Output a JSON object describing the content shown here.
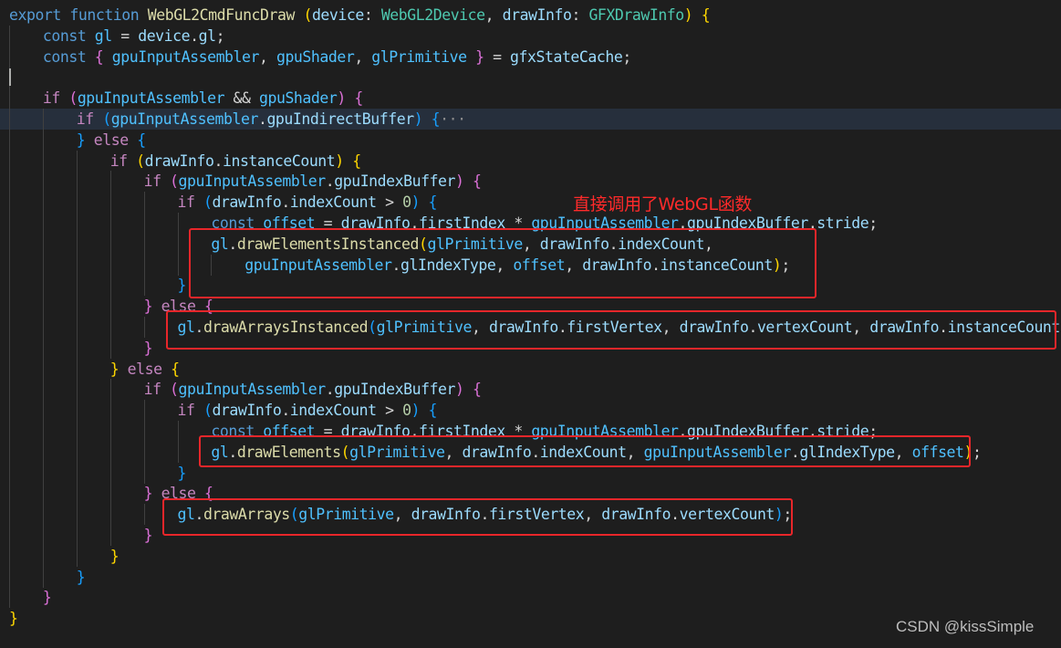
{
  "colors": {
    "background": "#1e1e1e",
    "highlight_line": "#262f3c",
    "keyword": "#569cd6",
    "control": "#c586c0",
    "function": "#dcdcaa",
    "type": "#4ec9b0",
    "variable": "#9cdcfe",
    "constant": "#4fc1ff",
    "number": "#b5cea8",
    "annotation_box": "#e8262a"
  },
  "code": [
    {
      "indent": 0,
      "tokens": [
        [
          "kw",
          "export"
        ],
        [
          "op",
          " "
        ],
        [
          "kw",
          "function"
        ],
        [
          "op",
          " "
        ],
        [
          "fn",
          "WebGL2CmdFuncDraw"
        ],
        [
          "op",
          " "
        ],
        [
          "br1",
          "("
        ],
        [
          "pv",
          "device"
        ],
        [
          "op",
          ": "
        ],
        [
          "ty",
          "WebGL2Device"
        ],
        [
          "op",
          ", "
        ],
        [
          "pv",
          "drawInfo"
        ],
        [
          "op",
          ": "
        ],
        [
          "ty",
          "GFXDrawInfo"
        ],
        [
          "br1",
          ")"
        ],
        [
          "op",
          " "
        ],
        [
          "br1",
          "{"
        ]
      ]
    },
    {
      "indent": 1,
      "tokens": [
        [
          "kw",
          "const"
        ],
        [
          "op",
          " "
        ],
        [
          "cn",
          "gl"
        ],
        [
          "op",
          " = "
        ],
        [
          "pv",
          "device"
        ],
        [
          "op",
          "."
        ],
        [
          "pv",
          "gl"
        ],
        [
          "op",
          ";"
        ]
      ]
    },
    {
      "indent": 1,
      "tokens": [
        [
          "kw",
          "const"
        ],
        [
          "op",
          " "
        ],
        [
          "br2",
          "{"
        ],
        [
          "op",
          " "
        ],
        [
          "cn",
          "gpuInputAssembler"
        ],
        [
          "op",
          ", "
        ],
        [
          "cn",
          "gpuShader"
        ],
        [
          "op",
          ", "
        ],
        [
          "cn",
          "glPrimitive"
        ],
        [
          "op",
          " "
        ],
        [
          "br2",
          "}"
        ],
        [
          "op",
          " = "
        ],
        [
          "pv",
          "gfxStateCache"
        ],
        [
          "op",
          ";"
        ]
      ]
    },
    {
      "indent": 1,
      "cursor": true,
      "tokens": []
    },
    {
      "indent": 1,
      "tokens": [
        [
          "ctl",
          "if"
        ],
        [
          "op",
          " "
        ],
        [
          "br2",
          "("
        ],
        [
          "cn",
          "gpuInputAssembler"
        ],
        [
          "op",
          " && "
        ],
        [
          "cn",
          "gpuShader"
        ],
        [
          "br2",
          ")"
        ],
        [
          "op",
          " "
        ],
        [
          "br2",
          "{"
        ]
      ]
    },
    {
      "indent": 2,
      "highlight": true,
      "tokens": [
        [
          "ctl",
          "if"
        ],
        [
          "op",
          " "
        ],
        [
          "br3",
          "("
        ],
        [
          "cn",
          "gpuInputAssembler"
        ],
        [
          "op",
          "."
        ],
        [
          "pv",
          "gpuIndirectBuffer"
        ],
        [
          "br3",
          ")"
        ],
        [
          "op",
          " "
        ],
        [
          "br3",
          "{"
        ],
        [
          "fold",
          "···"
        ]
      ]
    },
    {
      "indent": 2,
      "tokens": [
        [
          "br3",
          "}"
        ],
        [
          "op",
          " "
        ],
        [
          "ctl",
          "else"
        ],
        [
          "op",
          " "
        ],
        [
          "br3",
          "{"
        ]
      ]
    },
    {
      "indent": 3,
      "tokens": [
        [
          "ctl",
          "if"
        ],
        [
          "op",
          " "
        ],
        [
          "br1",
          "("
        ],
        [
          "pv",
          "drawInfo"
        ],
        [
          "op",
          "."
        ],
        [
          "pv",
          "instanceCount"
        ],
        [
          "br1",
          ")"
        ],
        [
          "op",
          " "
        ],
        [
          "br1",
          "{"
        ]
      ]
    },
    {
      "indent": 4,
      "tokens": [
        [
          "ctl",
          "if"
        ],
        [
          "op",
          " "
        ],
        [
          "br2",
          "("
        ],
        [
          "cn",
          "gpuInputAssembler"
        ],
        [
          "op",
          "."
        ],
        [
          "pv",
          "gpuIndexBuffer"
        ],
        [
          "br2",
          ")"
        ],
        [
          "op",
          " "
        ],
        [
          "br2",
          "{"
        ]
      ]
    },
    {
      "indent": 5,
      "tokens": [
        [
          "ctl",
          "if"
        ],
        [
          "op",
          " "
        ],
        [
          "br3",
          "("
        ],
        [
          "pv",
          "drawInfo"
        ],
        [
          "op",
          "."
        ],
        [
          "pv",
          "indexCount"
        ],
        [
          "op",
          " > "
        ],
        [
          "nm",
          "0"
        ],
        [
          "br3",
          ")"
        ],
        [
          "op",
          " "
        ],
        [
          "br3",
          "{"
        ]
      ]
    },
    {
      "indent": 6,
      "tokens": [
        [
          "kw",
          "const"
        ],
        [
          "op",
          " "
        ],
        [
          "cn",
          "offset"
        ],
        [
          "op",
          " = "
        ],
        [
          "pv",
          "drawInfo"
        ],
        [
          "op",
          "."
        ],
        [
          "pv",
          "firstIndex"
        ],
        [
          "op",
          " * "
        ],
        [
          "cn",
          "gpuInputAssembler"
        ],
        [
          "op",
          "."
        ],
        [
          "pv",
          "gpuIndexBuffer"
        ],
        [
          "op",
          "."
        ],
        [
          "pv",
          "stride"
        ],
        [
          "op",
          ";"
        ]
      ]
    },
    {
      "indent": 6,
      "tokens": [
        [
          "cn",
          "gl"
        ],
        [
          "op",
          "."
        ],
        [
          "fn",
          "drawElementsInstanced"
        ],
        [
          "br1",
          "("
        ],
        [
          "cn",
          "glPrimitive"
        ],
        [
          "op",
          ", "
        ],
        [
          "pv",
          "drawInfo"
        ],
        [
          "op",
          "."
        ],
        [
          "pv",
          "indexCount"
        ],
        [
          "op",
          ","
        ]
      ]
    },
    {
      "indent": 7,
      "tokens": [
        [
          "cn",
          "gpuInputAssembler"
        ],
        [
          "op",
          "."
        ],
        [
          "pv",
          "glIndexType"
        ],
        [
          "op",
          ", "
        ],
        [
          "cn",
          "offset"
        ],
        [
          "op",
          ", "
        ],
        [
          "pv",
          "drawInfo"
        ],
        [
          "op",
          "."
        ],
        [
          "pv",
          "instanceCount"
        ],
        [
          "br1",
          ")"
        ],
        [
          "op",
          ";"
        ]
      ]
    },
    {
      "indent": 5,
      "tokens": [
        [
          "br3",
          "}"
        ]
      ]
    },
    {
      "indent": 4,
      "tokens": [
        [
          "br2",
          "}"
        ],
        [
          "op",
          " "
        ],
        [
          "ctl",
          "else"
        ],
        [
          "op",
          " "
        ],
        [
          "br2",
          "{"
        ]
      ]
    },
    {
      "indent": 5,
      "tokens": [
        [
          "cn",
          "gl"
        ],
        [
          "op",
          "."
        ],
        [
          "fn",
          "drawArraysInstanced"
        ],
        [
          "br3",
          "("
        ],
        [
          "cn",
          "glPrimitive"
        ],
        [
          "op",
          ", "
        ],
        [
          "pv",
          "drawInfo"
        ],
        [
          "op",
          "."
        ],
        [
          "pv",
          "firstVertex"
        ],
        [
          "op",
          ", "
        ],
        [
          "pv",
          "drawInfo"
        ],
        [
          "op",
          "."
        ],
        [
          "pv",
          "vertexCount"
        ],
        [
          "op",
          ", "
        ],
        [
          "pv",
          "drawInfo"
        ],
        [
          "op",
          "."
        ],
        [
          "pv",
          "instanceCount"
        ],
        [
          "br3",
          ")"
        ],
        [
          "op",
          ";"
        ]
      ]
    },
    {
      "indent": 4,
      "tokens": [
        [
          "br2",
          "}"
        ]
      ]
    },
    {
      "indent": 3,
      "tokens": [
        [
          "br1",
          "}"
        ],
        [
          "op",
          " "
        ],
        [
          "ctl",
          "else"
        ],
        [
          "op",
          " "
        ],
        [
          "br1",
          "{"
        ]
      ]
    },
    {
      "indent": 4,
      "tokens": [
        [
          "ctl",
          "if"
        ],
        [
          "op",
          " "
        ],
        [
          "br2",
          "("
        ],
        [
          "cn",
          "gpuInputAssembler"
        ],
        [
          "op",
          "."
        ],
        [
          "pv",
          "gpuIndexBuffer"
        ],
        [
          "br2",
          ")"
        ],
        [
          "op",
          " "
        ],
        [
          "br2",
          "{"
        ]
      ]
    },
    {
      "indent": 5,
      "tokens": [
        [
          "ctl",
          "if"
        ],
        [
          "op",
          " "
        ],
        [
          "br3",
          "("
        ],
        [
          "pv",
          "drawInfo"
        ],
        [
          "op",
          "."
        ],
        [
          "pv",
          "indexCount"
        ],
        [
          "op",
          " > "
        ],
        [
          "nm",
          "0"
        ],
        [
          "br3",
          ")"
        ],
        [
          "op",
          " "
        ],
        [
          "br3",
          "{"
        ]
      ]
    },
    {
      "indent": 6,
      "tokens": [
        [
          "kw",
          "const"
        ],
        [
          "op",
          " "
        ],
        [
          "cn",
          "offset"
        ],
        [
          "op",
          " = "
        ],
        [
          "pv",
          "drawInfo"
        ],
        [
          "op",
          "."
        ],
        [
          "pv",
          "firstIndex"
        ],
        [
          "op",
          " * "
        ],
        [
          "cn",
          "gpuInputAssembler"
        ],
        [
          "op",
          "."
        ],
        [
          "pv",
          "gpuIndexBuffer"
        ],
        [
          "op",
          "."
        ],
        [
          "pv",
          "stride"
        ],
        [
          "op",
          ";"
        ]
      ]
    },
    {
      "indent": 6,
      "tokens": [
        [
          "cn",
          "gl"
        ],
        [
          "op",
          "."
        ],
        [
          "fn",
          "drawElements"
        ],
        [
          "br1",
          "("
        ],
        [
          "cn",
          "glPrimitive"
        ],
        [
          "op",
          ", "
        ],
        [
          "pv",
          "drawInfo"
        ],
        [
          "op",
          "."
        ],
        [
          "pv",
          "indexCount"
        ],
        [
          "op",
          ", "
        ],
        [
          "cn",
          "gpuInputAssembler"
        ],
        [
          "op",
          "."
        ],
        [
          "pv",
          "glIndexType"
        ],
        [
          "op",
          ", "
        ],
        [
          "cn",
          "offset"
        ],
        [
          "br1",
          ")"
        ],
        [
          "op",
          ";"
        ]
      ]
    },
    {
      "indent": 5,
      "tokens": [
        [
          "br3",
          "}"
        ]
      ]
    },
    {
      "indent": 4,
      "tokens": [
        [
          "br2",
          "}"
        ],
        [
          "op",
          " "
        ],
        [
          "ctl",
          "else"
        ],
        [
          "op",
          " "
        ],
        [
          "br2",
          "{"
        ]
      ]
    },
    {
      "indent": 5,
      "tokens": [
        [
          "cn",
          "gl"
        ],
        [
          "op",
          "."
        ],
        [
          "fn",
          "drawArrays"
        ],
        [
          "br3",
          "("
        ],
        [
          "cn",
          "glPrimitive"
        ],
        [
          "op",
          ", "
        ],
        [
          "pv",
          "drawInfo"
        ],
        [
          "op",
          "."
        ],
        [
          "pv",
          "firstVertex"
        ],
        [
          "op",
          ", "
        ],
        [
          "pv",
          "drawInfo"
        ],
        [
          "op",
          "."
        ],
        [
          "pv",
          "vertexCount"
        ],
        [
          "br3",
          ")"
        ],
        [
          "op",
          ";"
        ]
      ]
    },
    {
      "indent": 4,
      "tokens": [
        [
          "br2",
          "}"
        ]
      ]
    },
    {
      "indent": 3,
      "tokens": [
        [
          "br1",
          "}"
        ]
      ]
    },
    {
      "indent": 2,
      "tokens": [
        [
          "br3",
          "}"
        ]
      ]
    },
    {
      "indent": 1,
      "tokens": [
        [
          "br2",
          "}"
        ]
      ]
    },
    {
      "indent": 0,
      "tokens": [
        [
          "br1",
          "}"
        ]
      ]
    }
  ],
  "annotation": {
    "text": "直接调用了WebGL函数"
  },
  "watermark": "CSDN @kissSimple"
}
